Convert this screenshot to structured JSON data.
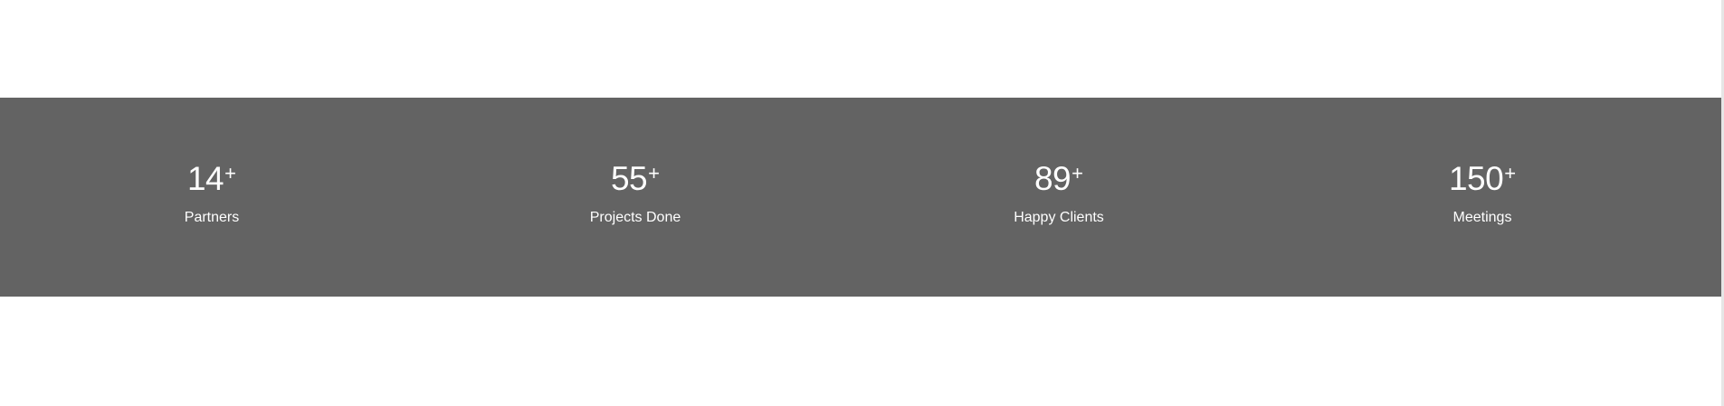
{
  "stats": [
    {
      "number": "14",
      "suffix": "+",
      "label": "Partners"
    },
    {
      "number": "55",
      "suffix": "+",
      "label": "Projects Done"
    },
    {
      "number": "89",
      "suffix": "+",
      "label": "Happy Clients"
    },
    {
      "number": "150",
      "suffix": "+",
      "label": "Meetings"
    }
  ],
  "colors": {
    "band_background": "#636363",
    "text": "#ffffff",
    "page_background": "#ffffff"
  }
}
